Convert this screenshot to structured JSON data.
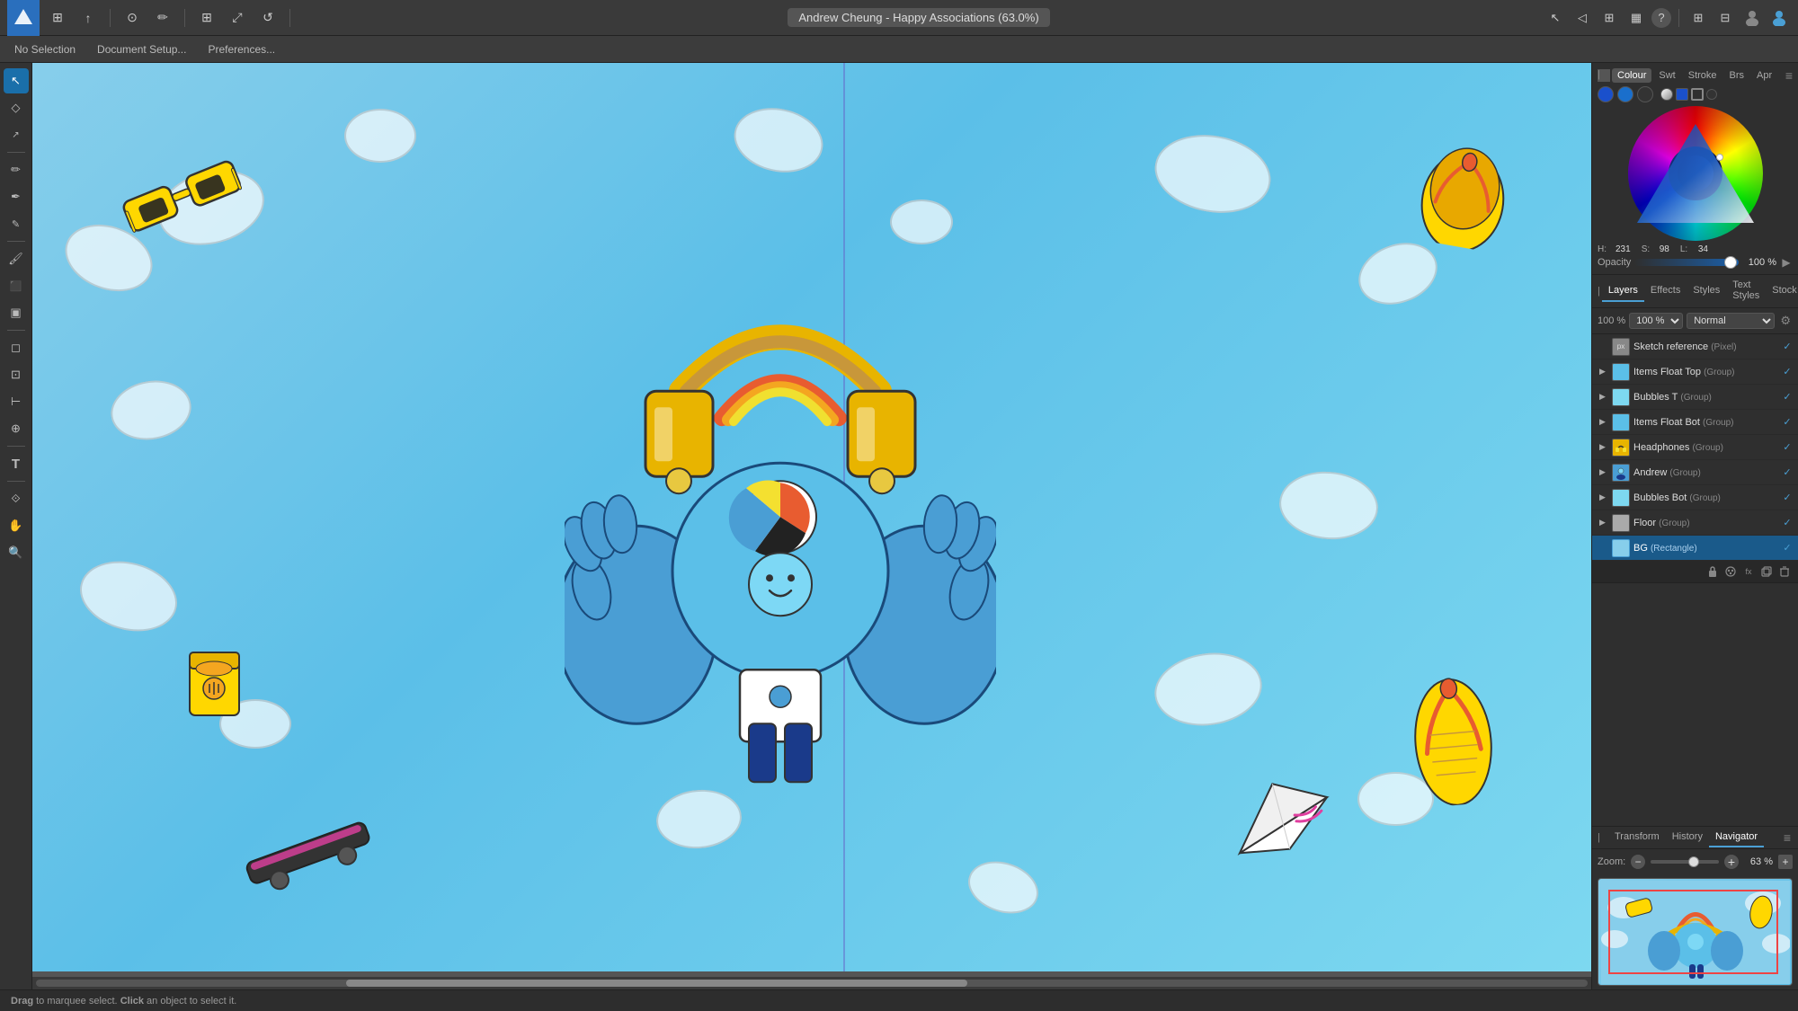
{
  "app": {
    "title": "Andrew Cheung - Happy Associations (63.0%)",
    "logo": "A"
  },
  "toolbar": {
    "left_icons": [
      "grid",
      "share",
      "camera",
      "brush",
      "grid2",
      "expand",
      "rotate"
    ],
    "right_icons": [
      "pointer",
      "back",
      "table",
      "layout",
      "question",
      "extend"
    ],
    "context_buttons": [
      "No Selection",
      "Document Setup...",
      "Preferences..."
    ],
    "right_tools": [
      "grid3x3",
      "grid2x2",
      "person",
      "person2"
    ]
  },
  "tools": {
    "items": [
      {
        "name": "pointer",
        "symbol": "↖",
        "active": true
      },
      {
        "name": "node",
        "symbol": "◇"
      },
      {
        "name": "subselect",
        "symbol": "↗"
      },
      {
        "name": "freehand",
        "symbol": "✏"
      },
      {
        "name": "pen",
        "symbol": "✒"
      },
      {
        "name": "pencil",
        "symbol": "✎"
      },
      {
        "name": "paint",
        "symbol": "🖌"
      },
      {
        "name": "fill",
        "symbol": "⬛"
      },
      {
        "name": "gradient",
        "symbol": "▣"
      },
      {
        "name": "erase",
        "symbol": "◻"
      },
      {
        "name": "crop",
        "symbol": "⊡"
      },
      {
        "name": "measure",
        "symbol": "⊢"
      },
      {
        "name": "zoom",
        "symbol": "⊕"
      },
      {
        "name": "text",
        "symbol": "T"
      },
      {
        "name": "blend",
        "symbol": "⟐"
      },
      {
        "name": "hand",
        "symbol": "✋"
      },
      {
        "name": "zoom2",
        "symbol": "🔍"
      }
    ]
  },
  "color_panel": {
    "tabs": [
      "Colour",
      "Swt",
      "Stroke",
      "Brs",
      "Apr"
    ],
    "swatches": [
      "#1a4faa",
      "#1a5fcc",
      "#333333"
    ],
    "hsl": {
      "h": "231",
      "s": "98",
      "l": "34"
    },
    "opacity": {
      "label": "Opacity",
      "value": "100 %"
    },
    "color_current": "#1a5fcc"
  },
  "layers_panel": {
    "tabs": [
      "Layers",
      "Effects",
      "Styles",
      "Text Styles",
      "Stock"
    ],
    "opacity_value": "100 %",
    "blend_mode": "Normal",
    "items": [
      {
        "name": "Sketch reference",
        "type": "(Pixel)",
        "visible": true,
        "has_arrow": false,
        "indent": 0,
        "color": "#aaa"
      },
      {
        "name": "Items Float Top",
        "type": "(Group)",
        "visible": true,
        "has_arrow": true,
        "indent": 0,
        "color": "#5BBFE8"
      },
      {
        "name": "Bubbles T",
        "type": "(Group)",
        "visible": true,
        "has_arrow": true,
        "indent": 0,
        "color": "#5BBFE8"
      },
      {
        "name": "Items Float Bot",
        "type": "(Group)",
        "visible": true,
        "has_arrow": true,
        "indent": 0,
        "color": "#5BBFE8"
      },
      {
        "name": "Headphones",
        "type": "(Group)",
        "visible": true,
        "has_arrow": true,
        "indent": 0,
        "color": "#E8B400"
      },
      {
        "name": "Andrew",
        "type": "(Group)",
        "visible": true,
        "has_arrow": true,
        "indent": 0,
        "color": "#4A9ED4"
      },
      {
        "name": "Bubbles Bot",
        "type": "(Group)",
        "visible": true,
        "has_arrow": true,
        "indent": 0,
        "color": "#5BBFE8"
      },
      {
        "name": "Floor",
        "type": "(Group)",
        "visible": true,
        "has_arrow": true,
        "indent": 0,
        "color": "#aaa"
      },
      {
        "name": "BG",
        "type": "(Rectangle)",
        "visible": true,
        "has_arrow": false,
        "indent": 0,
        "color": "#87CEEB",
        "selected": true
      }
    ],
    "bg_icons": [
      "lock",
      "palette",
      "fx"
    ]
  },
  "bottom_panel": {
    "tabs": [
      "Transform",
      "History",
      "Navigator"
    ],
    "active_tab": "Navigator",
    "zoom": {
      "label": "Zoom:",
      "value": "63 %",
      "min_icon": "−",
      "plus_icon": "+"
    }
  },
  "status_bar": {
    "drag_text": "Drag",
    "hint": " to marquee select. ",
    "click_text": "Click",
    "hint2": " an object to select it."
  }
}
